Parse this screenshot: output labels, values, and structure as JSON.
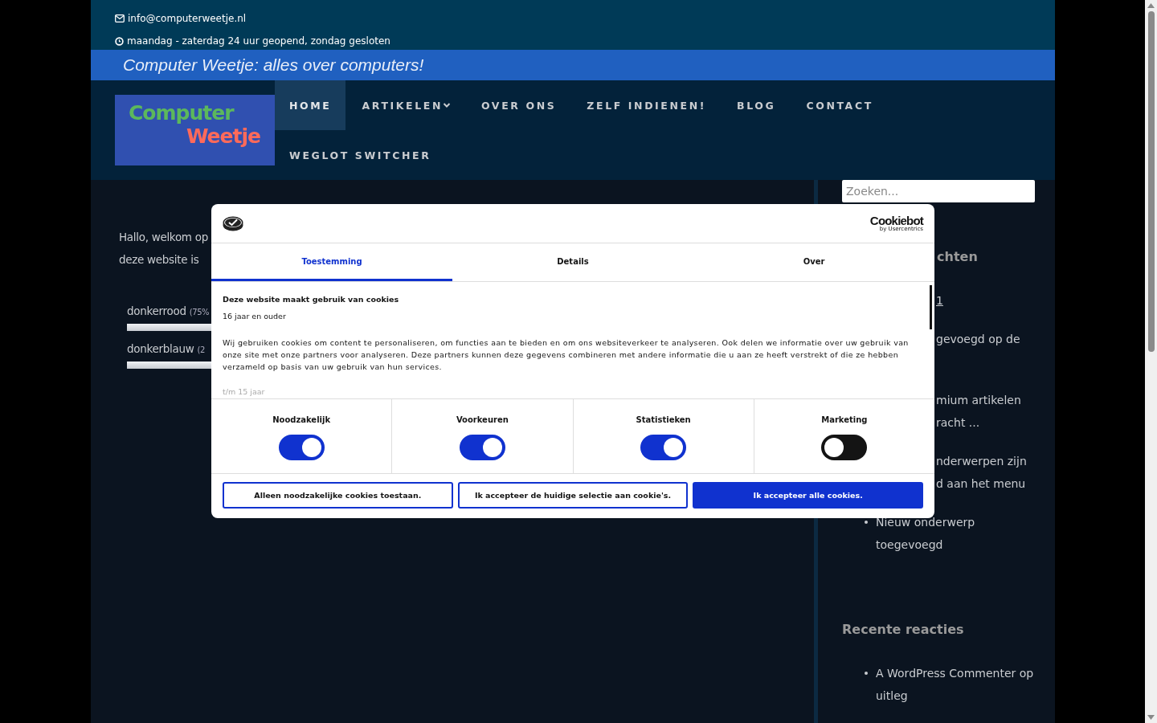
{
  "topbar": {
    "email": "info@computerweetje.nl",
    "hours": "maandag - zaterdag 24 uur geopend, zondag gesloten"
  },
  "banner": {
    "tagline": "Computer Weetje: alles over computers!"
  },
  "logo": {
    "line1": "Computer",
    "line2": "Weetje"
  },
  "nav": [
    {
      "label": "HOME",
      "selected": true,
      "submenu": false
    },
    {
      "label": "ARTIKELEN",
      "selected": false,
      "submenu": true
    },
    {
      "label": "OVER ONS",
      "selected": false,
      "submenu": false
    },
    {
      "label": "ZELF INDIENEN!",
      "selected": false,
      "submenu": false
    },
    {
      "label": "BLOG",
      "selected": false,
      "submenu": false
    },
    {
      "label": "CONTACT",
      "selected": false,
      "submenu": false
    },
    {
      "label": "WEGLOT SWITCHER",
      "selected": false,
      "submenu": false
    }
  ],
  "content": {
    "lines": [
      "Hallo, welkom op",
      "deze website is"
    ],
    "poll": [
      {
        "label": "donkerrood",
        "share": "(75%"
      },
      {
        "label": "donkerblauw",
        "share": "(2"
      }
    ]
  },
  "sidebar": {
    "search": {
      "placeholder": "Zoeken..."
    },
    "recent_posts": {
      "heading": "chten",
      "items": [
        {
          "lines": [
            "1"
          ],
          "bullet": false
        },
        {
          "lines": [
            "gevoegd op de"
          ],
          "bullet": false
        },
        {
          "lines": [
            "mium artikelen",
            "racht ..."
          ],
          "bullet": false
        },
        {
          "lines": [
            "nderwerpen zijn",
            "d aan het menu"
          ],
          "bullet": false
        },
        {
          "lines": [
            "Nieuw onderwerp",
            "toegevoegd"
          ],
          "bullet": true
        }
      ]
    },
    "recent_comments": {
      "heading": "Recente reacties",
      "items": [
        {
          "text": "A WordPress Commenter op uitleg"
        }
      ]
    }
  },
  "cookie_dialog": {
    "brand": "Cookiebot",
    "brand_sub": "by Usercentrics",
    "tabs": [
      {
        "label": "Toestemming",
        "selected": true
      },
      {
        "label": "Details",
        "selected": false
      },
      {
        "label": "Over",
        "selected": false
      }
    ],
    "title": "Deze website maakt gebruik van cookies",
    "age": "16 jaar en ouder",
    "body": "Wij gebruiken cookies om content te personaliseren, om functies aan te bieden en om ons websiteverkeer te analyseren. Ook delen we informatie over uw gebruik van onze site met onze partners voor analyseren. Deze partners kunnen deze gegevens combineren met andere informatie die u aan ze heeft verstrekt of die ze hebben verzameld op basis van uw gebruik van hun services.",
    "faded": "t/m 15 jaar",
    "toggles": [
      {
        "label": "Noodzakelijk",
        "on": true
      },
      {
        "label": "Voorkeuren",
        "on": true
      },
      {
        "label": "Statistieken",
        "on": true
      },
      {
        "label": "Marketing",
        "on": false
      }
    ],
    "buttons": [
      {
        "label": "Alleen noodzakelijke cookies toestaan.",
        "kind": "outline"
      },
      {
        "label": "Ik accepteer de huidige selectie aan cookie's.",
        "kind": "outline"
      },
      {
        "label": "Ik accepteer alle cookies.",
        "kind": "primary"
      }
    ]
  }
}
